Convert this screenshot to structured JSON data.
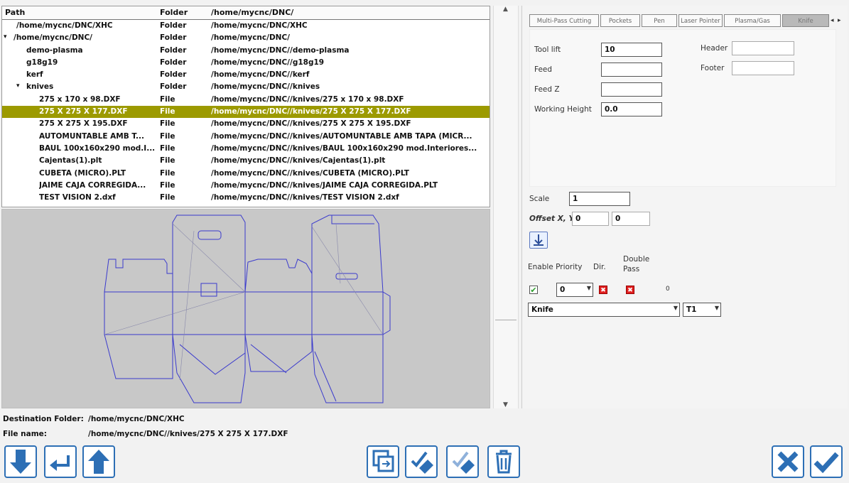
{
  "tree": {
    "headers": {
      "path": "Path",
      "folder": "Folder",
      "full": "/home/mycnc/DNC/"
    },
    "rows": [
      {
        "name": "/home/mycnc/DNC/XHC",
        "type": "Folder",
        "path": "/home/mycnc/DNC/XHC",
        "indent": 0,
        "arrow": ""
      },
      {
        "name": "/home/mycnc/DNC/",
        "type": "Folder",
        "path": "/home/mycnc/DNC/",
        "indent": 0,
        "arrow": "▾"
      },
      {
        "name": "demo-plasma",
        "type": "Folder",
        "path": "/home/mycnc/DNC//demo-plasma",
        "indent": 1,
        "arrow": ""
      },
      {
        "name": "g18g19",
        "type": "Folder",
        "path": "/home/mycnc/DNC//g18g19",
        "indent": 1,
        "arrow": ""
      },
      {
        "name": "kerf",
        "type": "Folder",
        "path": "/home/mycnc/DNC//kerf",
        "indent": 1,
        "arrow": ""
      },
      {
        "name": "knives",
        "type": "Folder",
        "path": "/home/mycnc/DNC//knives",
        "indent": 1,
        "arrow": "▾"
      },
      {
        "name": "275 x 170 x 98.DXF",
        "type": "File",
        "path": "/home/mycnc/DNC//knives/275 x 170 x 98.DXF",
        "indent": 2,
        "arrow": ""
      },
      {
        "name": "275 X 275 X 177.DXF",
        "type": "File",
        "path": "/home/mycnc/DNC//knives/275 X 275 X 177.DXF",
        "indent": 2,
        "arrow": "",
        "selected": true
      },
      {
        "name": "275 X 275 X 195.DXF",
        "type": "File",
        "path": "/home/mycnc/DNC//knives/275 X 275 X 195.DXF",
        "indent": 2,
        "arrow": ""
      },
      {
        "name": "AUTOMUNTABLE AMB T...",
        "type": "File",
        "path": "/home/mycnc/DNC//knives/AUTOMUNTABLE AMB TAPA (MICR...",
        "indent": 2,
        "arrow": ""
      },
      {
        "name": "BAUL 100x160x290 mod.I...",
        "type": "File",
        "path": "/home/mycnc/DNC//knives/BAUL 100x160x290 mod.Interiores...",
        "indent": 2,
        "arrow": ""
      },
      {
        "name": "Cajentas(1).plt",
        "type": "File",
        "path": "/home/mycnc/DNC//knives/Cajentas(1).plt",
        "indent": 2,
        "arrow": ""
      },
      {
        "name": "CUBETA (MICRO).PLT",
        "type": "File",
        "path": "/home/mycnc/DNC//knives/CUBETA (MICRO).PLT",
        "indent": 2,
        "arrow": ""
      },
      {
        "name": "JAIME CAJA CORREGIDA...",
        "type": "File",
        "path": "/home/mycnc/DNC//knives/JAIME CAJA CORREGIDA.PLT",
        "indent": 2,
        "arrow": ""
      },
      {
        "name": "TEST VISION 2.dxf",
        "type": "File",
        "path": "/home/mycnc/DNC//knives/TEST VISION 2.dxf",
        "indent": 2,
        "arrow": ""
      }
    ]
  },
  "tabs": [
    "Multi-Pass Cutting",
    "Pockets",
    "Pen",
    "Laser Pointer",
    "Plasma/Gas",
    "Knife"
  ],
  "settings": {
    "tool_lift_label": "Tool lift",
    "tool_lift_value": "10",
    "feed_label": "Feed",
    "feed_value": "",
    "feed_z_label": "Feed Z",
    "feed_z_value": "",
    "working_height_label": "Working Height",
    "working_height_value": "0.0",
    "header_label": "Header",
    "header_value": "",
    "footer_label": "Footer",
    "footer_value": ""
  },
  "lower": {
    "scale_label": "Scale",
    "scale_value": "1",
    "offset_label": "Offset X, Y",
    "offset_x": "0",
    "offset_y": "0",
    "enable_label": "Enable Priority",
    "dir_label": "Dir.",
    "double_pass_label": "Double Pass",
    "priority_value": "0",
    "count_value": "0",
    "tool_select": "Knife",
    "t_select": "T1"
  },
  "info": {
    "dest_label": "Destination Folder:",
    "dest_value": "/home/mycnc/DNC/XHC",
    "file_label": "File name:",
    "file_value": "/home/mycnc/DNC//knives/275 X 275 X 177.DXF"
  },
  "colors": {
    "accent": "#2d6fb5",
    "selected_row": "#9c9a00",
    "drawing": "#3a3acd"
  }
}
